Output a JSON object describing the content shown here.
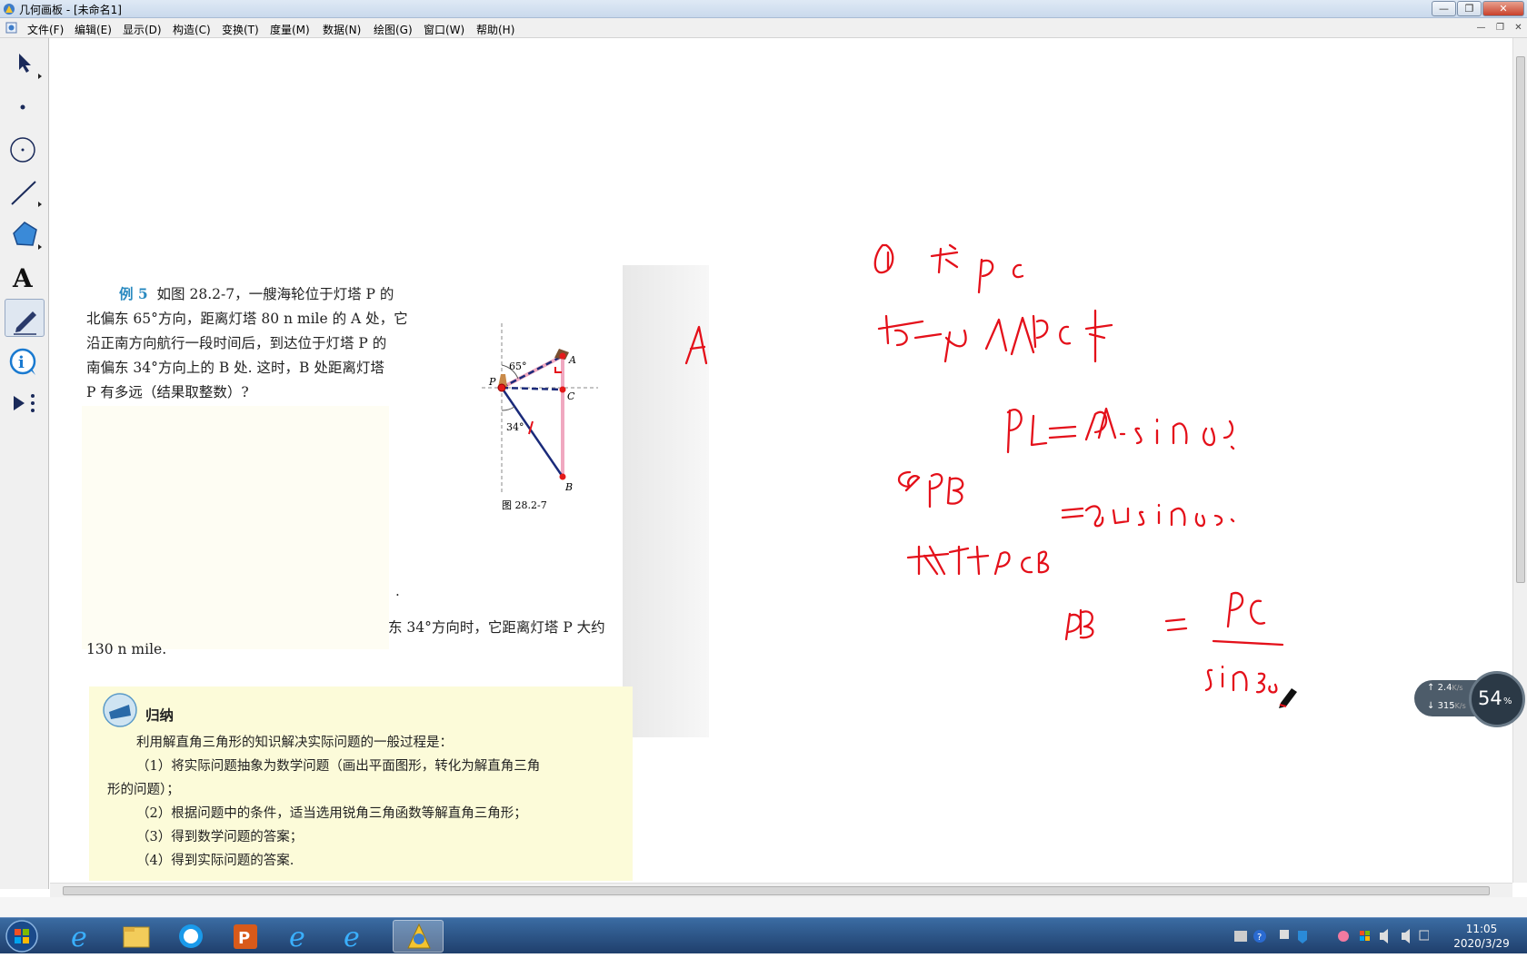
{
  "window": {
    "title": "几何画板 - [未命名1]",
    "controls": {
      "minimize": "—",
      "restore": "❐",
      "close": "✕"
    }
  },
  "menubar": {
    "items": [
      "文件(F)",
      "编辑(E)",
      "显示(D)",
      "构造(C)",
      "变换(T)",
      "度量(M)",
      "数据(N)",
      "绘图(G)",
      "窗口(W)",
      "帮助(H)"
    ],
    "mdi_controls": {
      "minimize": "—",
      "restore": "❐",
      "close": "✕"
    }
  },
  "toolbox": {
    "tools": [
      "arrow-tool",
      "point-tool",
      "compass-tool",
      "straightedge-tool",
      "polygon-tool",
      "text-tool",
      "marker-tool",
      "information-tool",
      "custom-tool"
    ],
    "selected": "marker-tool"
  },
  "textbook": {
    "example_label": "例 5",
    "problem_lines": [
      "如图 28.2-7，一艘海轮位于灯塔 P 的",
      "北偏东 65°方向，距离灯塔 80 n mile 的 A 处，它",
      "沿正南方向航行一段时间后，到达位于灯塔 P 的",
      "南偏东 34°方向上的 B 处. 这时，B 处距离灯塔",
      "P 有多远（结果取整数）?"
    ],
    "figure": {
      "caption": "图 28.2-7",
      "angle_top": "65°",
      "angle_bottom": "34°",
      "points": [
        "P",
        "A",
        "C",
        "B"
      ]
    },
    "dot": ".",
    "answer_line_1": "东 34°方向时，它距离灯塔 P 大约",
    "answer_line_2": "130 n mile.",
    "summary": {
      "heading": "归纳",
      "lines": [
        "利用解直角三角形的知识解决实际问题的一般过程是：",
        "（1）将实际问题抽象为数学问题（画出平面图形，转化为解直角三角",
        "形的问题）；",
        "（2）根据问题中的条件，适当选用锐角三角函数等解直角三角形；",
        "（3）得到数学问题的答案；",
        "（4）得到实际问题的答案."
      ]
    }
  },
  "network_widget": {
    "upload": "2.4",
    "upload_unit": "K/s",
    "download": "315",
    "download_unit": "K/s",
    "percent": "54",
    "percent_unit": "%"
  },
  "taskbar": {
    "apps": [
      "start-button",
      "ie-icon",
      "file-explorer-icon",
      "qq-icon",
      "powerpoint-icon",
      "ie-icon",
      "ie-icon",
      "geometers-sketchpad-icon"
    ],
    "time": "11:05",
    "date": "2020/3/29"
  },
  "colors": {
    "ink": "#e4101a",
    "figure_blue": "#1a2a7a",
    "figure_pink": "#f0a8c0",
    "summary_bg": "#fcfbd9"
  }
}
